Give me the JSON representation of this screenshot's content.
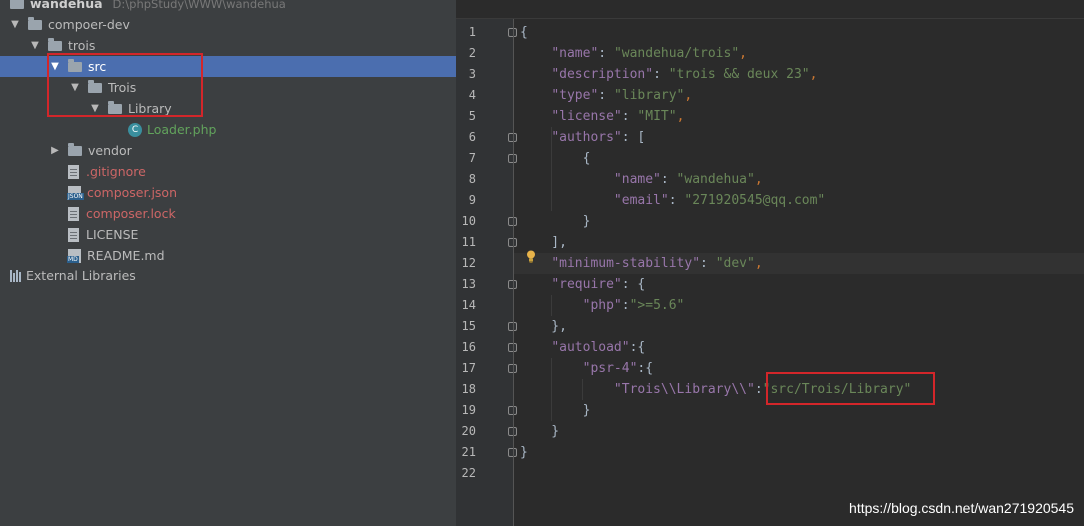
{
  "project_tree": {
    "root": {
      "label": "wandehua",
      "path": "D:\\phpStudy\\WWW\\wandehua"
    },
    "items": [
      {
        "label": "compoer-dev",
        "kind": "folder",
        "level": 0,
        "expanded": true
      },
      {
        "label": "trois",
        "kind": "folder",
        "level": 1,
        "expanded": true
      },
      {
        "label": "src",
        "kind": "folder",
        "level": 2,
        "expanded": true,
        "selected": true
      },
      {
        "label": "Trois",
        "kind": "folder",
        "level": 3,
        "expanded": true
      },
      {
        "label": "Library",
        "kind": "folder",
        "level": 4,
        "expanded": true
      },
      {
        "label": "Loader.php",
        "kind": "class",
        "level": 5
      },
      {
        "label": "vendor",
        "kind": "folder",
        "level": 2,
        "expanded": false
      },
      {
        "label": ".gitignore",
        "kind": "file",
        "level": 2,
        "status": "ignored"
      },
      {
        "label": "composer.json",
        "kind": "json",
        "level": 2,
        "status": "ignored"
      },
      {
        "label": "composer.lock",
        "kind": "file",
        "level": 2,
        "status": "ignored"
      },
      {
        "label": "LICENSE",
        "kind": "file",
        "level": 2
      },
      {
        "label": "README.md",
        "kind": "md",
        "level": 2
      }
    ],
    "external": "External Libraries",
    "badges": {
      "json": "JSON",
      "md": "MD",
      "class": "C"
    }
  },
  "editor": {
    "lines": [
      {
        "n": "1",
        "fold": true,
        "tokens": [
          {
            "t": "{",
            "c": "plain"
          }
        ]
      },
      {
        "n": "2",
        "tokens": [
          {
            "t": "    ",
            "c": "plain"
          },
          {
            "t": "\"name\"",
            "c": "key"
          },
          {
            "t": ": ",
            "c": "plain"
          },
          {
            "t": "\"wandehua/trois\"",
            "c": "str"
          },
          {
            "t": ",",
            "c": "punc"
          }
        ]
      },
      {
        "n": "3",
        "tokens": [
          {
            "t": "    ",
            "c": "plain"
          },
          {
            "t": "\"description\"",
            "c": "key"
          },
          {
            "t": ": ",
            "c": "plain"
          },
          {
            "t": "\"trois && deux 23\"",
            "c": "str"
          },
          {
            "t": ",",
            "c": "punc"
          }
        ]
      },
      {
        "n": "4",
        "tokens": [
          {
            "t": "    ",
            "c": "plain"
          },
          {
            "t": "\"type\"",
            "c": "key"
          },
          {
            "t": ": ",
            "c": "plain"
          },
          {
            "t": "\"library\"",
            "c": "str"
          },
          {
            "t": ",",
            "c": "punc"
          }
        ]
      },
      {
        "n": "5",
        "tokens": [
          {
            "t": "    ",
            "c": "plain"
          },
          {
            "t": "\"license\"",
            "c": "key"
          },
          {
            "t": ": ",
            "c": "plain"
          },
          {
            "t": "\"MIT\"",
            "c": "str"
          },
          {
            "t": ",",
            "c": "punc"
          }
        ]
      },
      {
        "n": "6",
        "fold": true,
        "tokens": [
          {
            "t": "    ",
            "c": "plain"
          },
          {
            "t": "\"authors\"",
            "c": "key"
          },
          {
            "t": ": [",
            "c": "plain"
          }
        ]
      },
      {
        "n": "7",
        "fold": true,
        "tokens": [
          {
            "t": "        {",
            "c": "plain"
          }
        ]
      },
      {
        "n": "8",
        "tokens": [
          {
            "t": "            ",
            "c": "plain"
          },
          {
            "t": "\"name\"",
            "c": "key"
          },
          {
            "t": ": ",
            "c": "plain"
          },
          {
            "t": "\"wandehua\"",
            "c": "str"
          },
          {
            "t": ",",
            "c": "punc"
          }
        ]
      },
      {
        "n": "9",
        "tokens": [
          {
            "t": "            ",
            "c": "plain"
          },
          {
            "t": "\"email\"",
            "c": "key"
          },
          {
            "t": ": ",
            "c": "plain"
          },
          {
            "t": "\"271920545@qq.com\"",
            "c": "str"
          }
        ]
      },
      {
        "n": "10",
        "fold": true,
        "tokens": [
          {
            "t": "        }",
            "c": "plain"
          }
        ]
      },
      {
        "n": "11",
        "fold": true,
        "tokens": [
          {
            "t": "    ],",
            "c": "plain"
          }
        ]
      },
      {
        "n": "12",
        "current": true,
        "tokens": [
          {
            "t": "    ",
            "c": "plain"
          },
          {
            "t": "\"minimum-stability\"",
            "c": "key"
          },
          {
            "t": ": ",
            "c": "plain"
          },
          {
            "t": "\"dev\"",
            "c": "str"
          },
          {
            "t": ",",
            "c": "punc"
          }
        ]
      },
      {
        "n": "13",
        "fold": true,
        "tokens": [
          {
            "t": "    ",
            "c": "plain"
          },
          {
            "t": "\"require\"",
            "c": "key"
          },
          {
            "t": ": {",
            "c": "plain"
          }
        ]
      },
      {
        "n": "14",
        "tokens": [
          {
            "t": "        ",
            "c": "plain"
          },
          {
            "t": "\"php\"",
            "c": "key"
          },
          {
            "t": ":",
            "c": "plain"
          },
          {
            "t": "\">=5.6\"",
            "c": "str"
          }
        ]
      },
      {
        "n": "15",
        "fold": true,
        "tokens": [
          {
            "t": "    },",
            "c": "plain"
          }
        ]
      },
      {
        "n": "16",
        "fold": true,
        "tokens": [
          {
            "t": "    ",
            "c": "plain"
          },
          {
            "t": "\"autoload\"",
            "c": "key"
          },
          {
            "t": ":{",
            "c": "plain"
          }
        ]
      },
      {
        "n": "17",
        "fold": true,
        "tokens": [
          {
            "t": "        ",
            "c": "plain"
          },
          {
            "t": "\"psr-4\"",
            "c": "key"
          },
          {
            "t": ":{",
            "c": "plain"
          }
        ]
      },
      {
        "n": "18",
        "tokens": [
          {
            "t": "            ",
            "c": "plain"
          },
          {
            "t": "\"Trois\\\\Library\\\\\"",
            "c": "key"
          },
          {
            "t": ":",
            "c": "plain"
          },
          {
            "t": "\"src/Trois/Library\"",
            "c": "str"
          }
        ]
      },
      {
        "n": "19",
        "fold": true,
        "tokens": [
          {
            "t": "        }",
            "c": "plain"
          }
        ]
      },
      {
        "n": "20",
        "fold": true,
        "tokens": [
          {
            "t": "    }",
            "c": "plain"
          }
        ]
      },
      {
        "n": "21",
        "fold": true,
        "tokens": [
          {
            "t": "}",
            "c": "plain"
          }
        ]
      },
      {
        "n": "22",
        "tokens": []
      }
    ]
  },
  "watermark": "https://blog.csdn.net/wan271920545",
  "colors": {
    "selection": "#4b6eaf",
    "highlight_box": "#d3262a"
  }
}
